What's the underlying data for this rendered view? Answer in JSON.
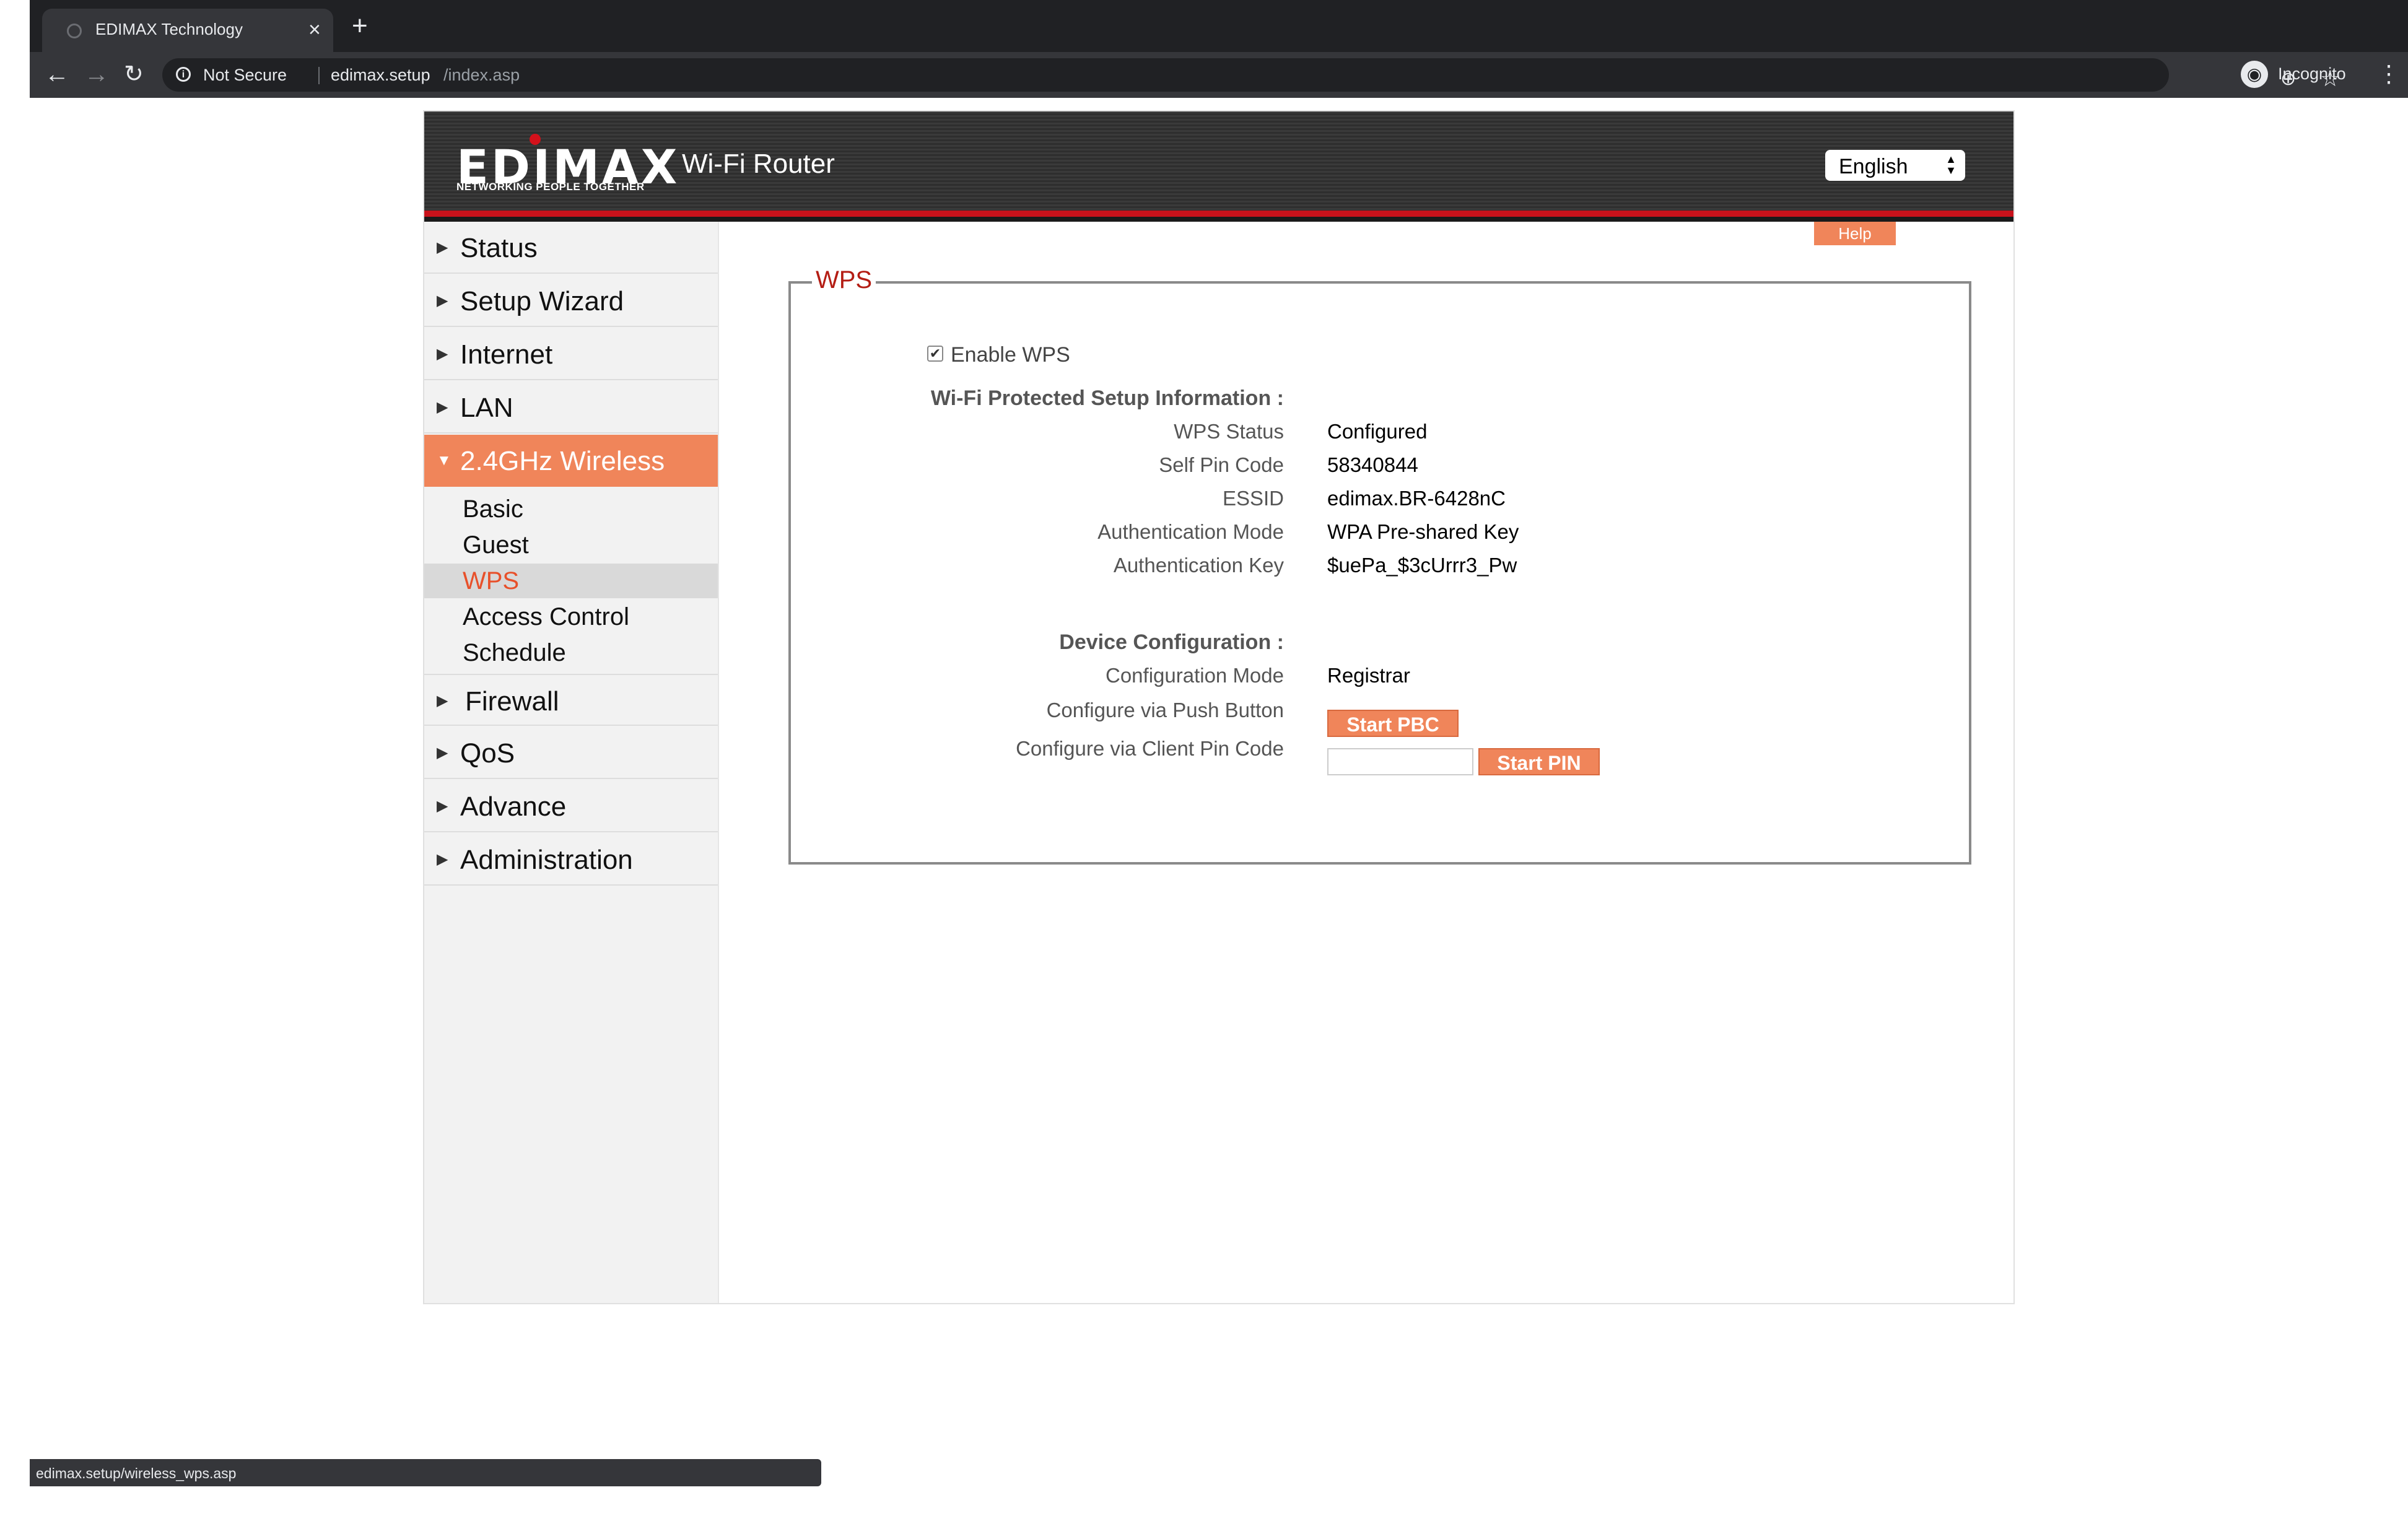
{
  "browser": {
    "tab_title": "EDIMAX Technology",
    "tab_close": "×",
    "new_tab": "+",
    "security_label": "Not Secure",
    "url_host": "edimax.setup",
    "url_path": "/index.asp",
    "profile_label": "Incognito",
    "status_url": "edimax.setup/wireless_wps.asp"
  },
  "header": {
    "logo_text": "EDIMAX",
    "logo_tagline": "NETWORKING PEOPLE TOGETHER",
    "product_title": "Wi-Fi Router",
    "language": "English",
    "accent_color": "#c8121b"
  },
  "sidebar": {
    "items": [
      {
        "label": "Status"
      },
      {
        "label": "Setup Wizard"
      },
      {
        "label": "Internet"
      },
      {
        "label": "LAN"
      },
      {
        "label": "2.4GHz Wireless"
      },
      {
        "label": "Firewall"
      },
      {
        "label": "QoS"
      },
      {
        "label": "Advance"
      },
      {
        "label": "Administration"
      }
    ],
    "wireless_subitems": [
      {
        "label": "Basic"
      },
      {
        "label": "Guest"
      },
      {
        "label": "WPS"
      },
      {
        "label": "Access Control"
      },
      {
        "label": "Schedule"
      }
    ],
    "active_color": "#f0855a"
  },
  "main": {
    "help_label": "Help",
    "legend": "WPS",
    "enable_wps_label": "Enable  WPS",
    "enable_wps_checked": true,
    "info_heading": "Wi-Fi Protected Setup Information  :",
    "info_rows": [
      {
        "label": "WPS Status",
        "value": "Configured"
      },
      {
        "label": "Self Pin Code",
        "value": "58340844"
      },
      {
        "label": "ESSID",
        "value": "edimax.BR-6428nC"
      },
      {
        "label": "Authentication Mode",
        "value": "WPA Pre-shared Key"
      },
      {
        "label": "Authentication Key",
        "value": "$uePa_$3cUrrr3_Pw"
      }
    ],
    "device_heading": "Device Configuration  :",
    "config_mode_label": "Configuration Mode",
    "config_mode_value": "Registrar",
    "push_button_label": "Configure via Push Button",
    "start_pbc_label": "Start PBC",
    "client_pin_label": "Configure via Client Pin Code",
    "client_pin_value": "",
    "start_pin_label": "Start PIN"
  }
}
